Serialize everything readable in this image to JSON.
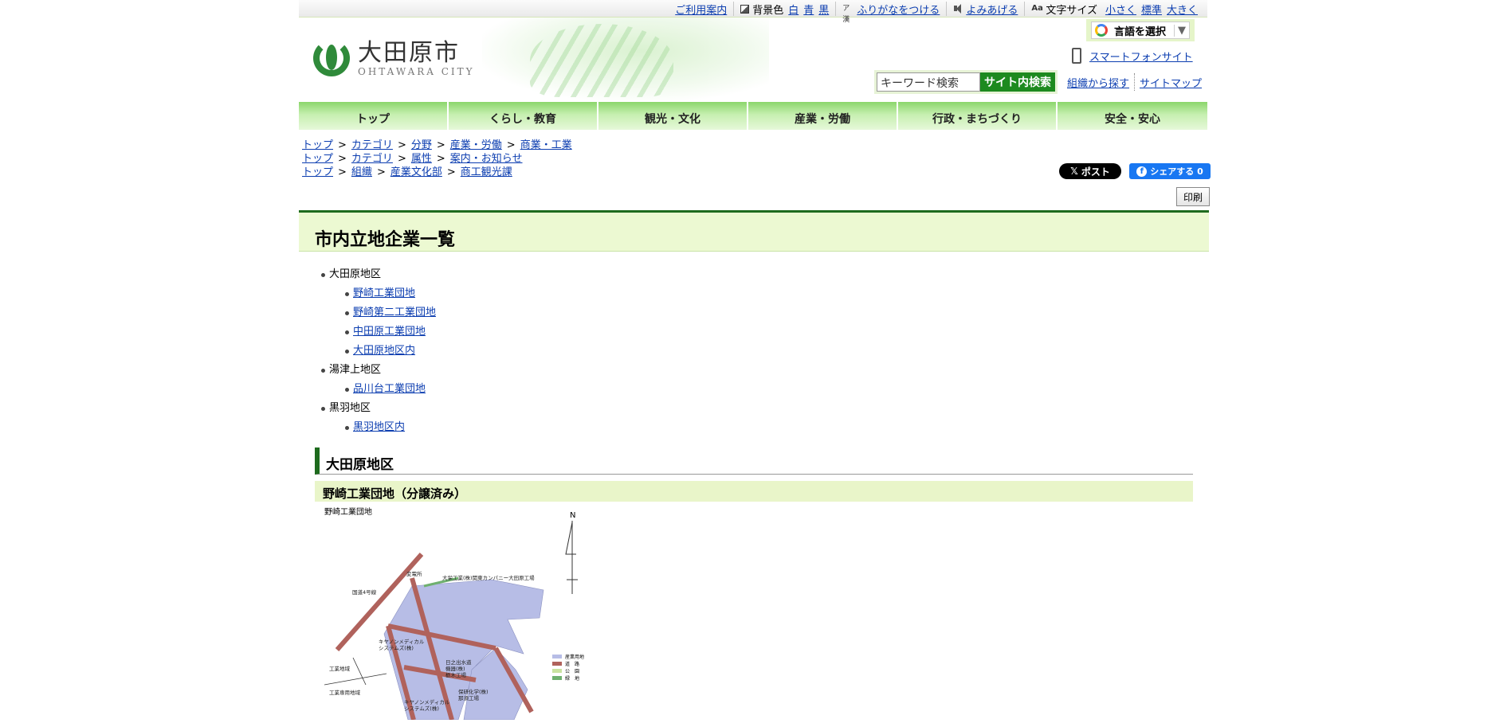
{
  "utility_bar": {
    "usage_guide": "ご利用案内",
    "bg_color_label": "背景色",
    "bg_colors": [
      "白",
      "青",
      "黒"
    ],
    "furigana": "ふりがなをつける",
    "read_aloud": "よみあげる",
    "text_size_label": "文字サイズ",
    "text_sizes": [
      "小さく",
      "標準",
      "大きく"
    ]
  },
  "header": {
    "logo_jp": "大田原市",
    "logo_en": "OHTAWARA CITY",
    "translate_label": "言語を選択",
    "translate_arrow": "▼",
    "smartphone_link": "スマートフォンサイト",
    "search_placeholder": "キーワード検索",
    "search_button": "サイト内検索",
    "org_link": "組織から探す",
    "sitemap_link": "サイトマップ"
  },
  "nav": [
    "トップ",
    "くらし・教育",
    "観光・文化",
    "産業・労働",
    "行政・まちづくり",
    "安全・安心"
  ],
  "breadcrumbs": [
    [
      "トップ",
      "カテゴリ",
      "分野",
      "産業・労働",
      "商業・工業"
    ],
    [
      "トップ",
      "カテゴリ",
      "属性",
      "案内・お知らせ"
    ],
    [
      "トップ",
      "組織",
      "産業文化部",
      "商工観光課"
    ]
  ],
  "social": {
    "x_post": "ポスト",
    "fb_share": "シェアする 0"
  },
  "print_button": "印刷",
  "page_title": "市内立地企業一覧",
  "toc": [
    {
      "label": "大田原地区",
      "children": [
        "野崎工業団地",
        "野崎第二工業団地",
        "中田原工業団地",
        "大田原地区内"
      ]
    },
    {
      "label": "湯津上地区",
      "children": [
        "品川台工業団地"
      ]
    },
    {
      "label": "黒羽地区",
      "children": [
        "黒羽地区内"
      ]
    }
  ],
  "section_heading": "大田原地区",
  "subsection_heading": "野崎工業団地（分譲済み）",
  "map": {
    "title": "野崎工業団地",
    "north": "N",
    "labels": {
      "route4": "国道4号線",
      "substation": "変電所",
      "company_top": "大栄工業(株)関東カンパニー大田原工場",
      "canon1": "キヤノンメディカル\nシステムズ(株)",
      "nikko": "日之出水道\n機器(株)\n栃木工場",
      "hoken": "保研化学(株)\n那須工場",
      "canon2": "キヤノンメディカル\nシステムズ(株)",
      "industrial": "工業地域",
      "exclusive": "工業専用地域"
    },
    "legend": [
      "産業用地",
      "道　路",
      "公　園",
      "緑　地"
    ],
    "legend_colors": [
      "#b7bde6",
      "#b0625c",
      "#c9e3a0",
      "#6fb06f"
    ]
  }
}
